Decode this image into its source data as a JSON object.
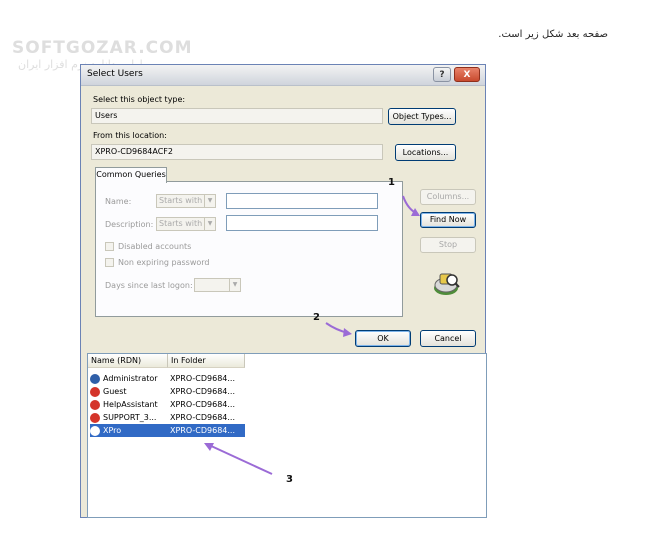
{
  "page": {
    "caption": "صفحه بعد شکل زیر است.",
    "watermark_brand": "SOFTGOZAR.COM",
    "watermark_sub": "اولین دانلود نرم افزار ایران"
  },
  "dialog": {
    "title": "Select Users",
    "help_symbol": "?",
    "close_symbol": "X",
    "object_type_label": "Select this object type:",
    "object_type_value": "Users",
    "object_types_button": "Object Types...",
    "location_label": "From this location:",
    "location_value": "XPRO-CD9684ACF2",
    "locations_button": "Locations...",
    "tab_label": "Common Queries",
    "name_label": "Name:",
    "name_mode": "Starts with",
    "description_label": "Description:",
    "description_mode": "Starts with",
    "disabled_accounts_label": "Disabled accounts",
    "non_expiring_label": "Non expiring password",
    "days_since_label": "Days since last logon:",
    "columns_button": "Columns...",
    "find_now_button": "Find Now",
    "stop_button": "Stop",
    "ok_button": "OK",
    "cancel_button": "Cancel"
  },
  "results": {
    "columns": [
      "Name (RDN)",
      "In Folder"
    ],
    "rows": [
      {
        "name": "Administrator",
        "folder": "XPRO-CD9684..."
      },
      {
        "name": "Guest",
        "folder": "XPRO-CD9684..."
      },
      {
        "name": "HelpAssistant",
        "folder": "XPRO-CD9684..."
      },
      {
        "name": "SUPPORT_3...",
        "folder": "XPRO-CD9684..."
      },
      {
        "name": "XPro",
        "folder": "XPRO-CD9684..."
      }
    ]
  },
  "annotations": [
    "1",
    "2",
    "3"
  ],
  "colors": {
    "arrow": "#9b6bd6",
    "selection": "#316ac5",
    "icon_red": "#d4342a"
  }
}
